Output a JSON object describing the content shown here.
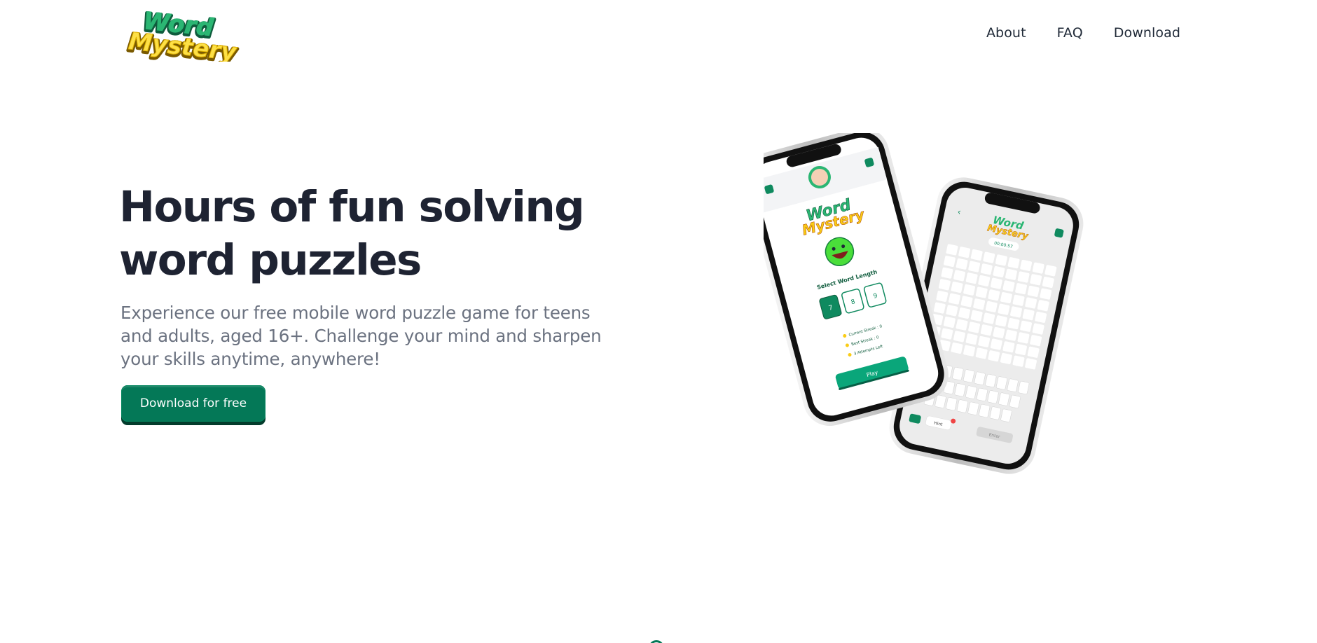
{
  "brand": {
    "logo_word_top": "Word",
    "logo_word_bottom": "Mystery",
    "color_green": "#2bb673",
    "color_yellow": "#fde047"
  },
  "nav": {
    "items": [
      "About",
      "FAQ",
      "Download"
    ]
  },
  "hero": {
    "title_line1": "Hours of fun solving",
    "title_line2": "word puzzles",
    "subtitle": "Experience our free mobile word puzzle game for teens and adults, aged 16+. Challenge your mind and sharpen your skills anytime, anywhere!",
    "cta_label": "Download for free"
  },
  "phone_left": {
    "select_label": "Select Word Length",
    "lengths": [
      "7",
      "8",
      "9"
    ],
    "selected_length": "7",
    "stats": [
      "Current Streak : 0",
      "Best Streak : 0",
      "3 Attempts Left"
    ],
    "play_label": "Play"
  },
  "phone_right": {
    "timer": "00:00:57",
    "hint_label": "Hint",
    "enter_label": "Enter"
  },
  "colors": {
    "accent": "#047857",
    "accent_dark": "#033c2c",
    "title": "#1e2332",
    "subtitle": "#6b7280"
  }
}
